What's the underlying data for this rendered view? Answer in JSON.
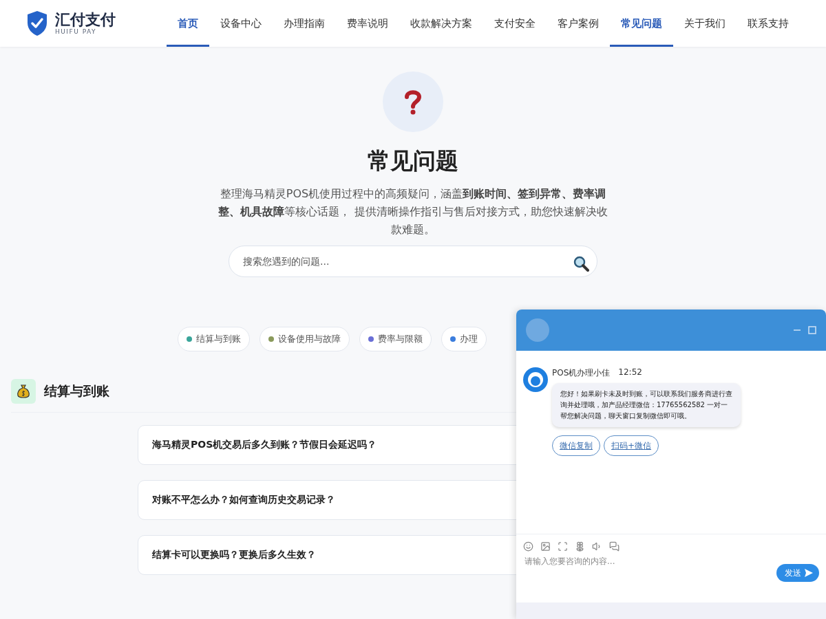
{
  "brand": {
    "name": "汇付支付",
    "tagline": "HUIFU PAY"
  },
  "nav": [
    {
      "label": "首页",
      "selected": true
    },
    {
      "label": "设备中心",
      "selected": false
    },
    {
      "label": "办理指南",
      "selected": false
    },
    {
      "label": "费率说明",
      "selected": false
    },
    {
      "label": "收款解决方案",
      "selected": false
    },
    {
      "label": "支付安全",
      "selected": false
    },
    {
      "label": "客户案例",
      "selected": false
    },
    {
      "label": "常见问题",
      "selected": true
    },
    {
      "label": "关于我们",
      "selected": false
    },
    {
      "label": "联系支持",
      "selected": false
    }
  ],
  "hero": {
    "title": "常见问题",
    "description": "整理海马精灵POS机使用过程中的高频疑问，涵盖**到账时间、签到异常、费率调整、机具故障**等核心话题， 提供清晰操作指引与售后对接方式，助您快速解决收款难题。",
    "search": {
      "placeholder": "搜索您遇到的问题..."
    }
  },
  "categories": [
    {
      "label": "结算与到账",
      "color": "#3aa59a"
    },
    {
      "label": "设备使用与故障",
      "color": "#8a9a5b"
    },
    {
      "label": "费率与限额",
      "color": "#6a6fd6"
    },
    {
      "label": "办理",
      "color": "#3b7ddd"
    }
  ],
  "section": {
    "title": "结算与到账",
    "questions": [
      "海马精灵POS机交易后多久到账？节假日会延迟吗？",
      "对账不平怎么办？如何查询历史交易记录？",
      "结算卡可以更换吗？更换后多久生效？"
    ]
  },
  "chat": {
    "agent": "POS机办理小佳",
    "time": "12:52",
    "message": "您好！如果刷卡未及时到账，可以联系我们服务商进行查询并处理哦，加产品经理微信：17765562582 一对一帮您解决问题，聊天窗口复制微信即可哦。",
    "actions": [
      "微信复制",
      "扫码+微信"
    ],
    "input": {
      "placeholder": "请输入您要咨询的内容..."
    },
    "send": "发送"
  }
}
